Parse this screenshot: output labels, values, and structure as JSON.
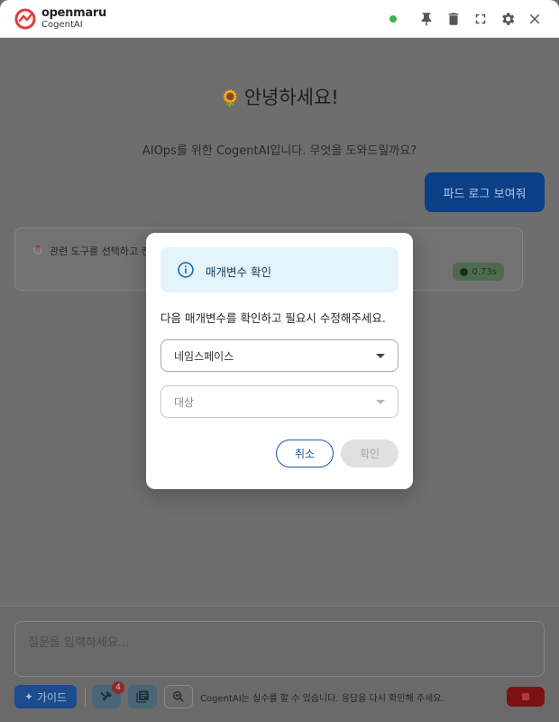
{
  "header": {
    "brand_name": "openmaru",
    "brand_sub": "CogentAI",
    "status_color": "#3bb54a",
    "icons": [
      "pin-icon",
      "trash-icon",
      "fullscreen-icon",
      "gear-icon",
      "close-icon"
    ]
  },
  "main": {
    "greeting_emoji": "🌻",
    "greeting": "안녕하세요!",
    "intro": "AIOps를 위한 CogentAI입니다. 무엇을 도와드릴까요?",
    "user_message": "파드 로그 보여줘",
    "bot_status_text": "관련 도구를 선택하고 컨",
    "elapsed": "0.73s"
  },
  "modal": {
    "title": "매개변수 확인",
    "message": "다음 매개변수를 확인하고 필요시 수정해주세요.",
    "namespace_label": "네임스페이스",
    "target_label": "대상",
    "cancel_label": "취소",
    "confirm_label": "확인"
  },
  "input_area": {
    "placeholder": "질문을 입력하세요...",
    "guide_label": "가이드",
    "tools_badge": "4",
    "disclaimer": "CogentAI는 실수를 할 수 있습니다. 응답을 다시 확인해 주세요."
  },
  "colors": {
    "brand_red": "#e03a3e",
    "accent_blue": "#1a5a9e",
    "banner_bg": "#e4f4fb"
  }
}
